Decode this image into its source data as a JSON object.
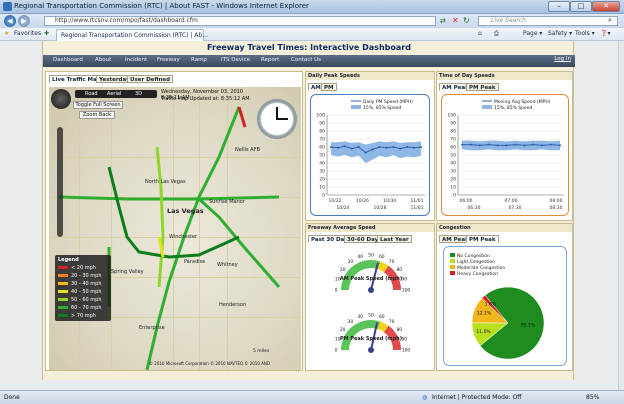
{
  "window": {
    "title": "Regional Transportation Commission (RTC) | About FAST - Windows Internet Explorer",
    "min": "–",
    "max": "□",
    "close": "✕"
  },
  "address": {
    "url": "http://www.rtcsnv.com/mpo/fast/dashboard.cfm",
    "search_placeholder": "Live Search"
  },
  "favbar": {
    "favorites": "Favorites",
    "tab_title": "Regional Transportation Commission (RTC) | Ab...",
    "tools": [
      "Page ▾",
      "Safety ▾",
      "Tools ▾",
      "❓▾"
    ]
  },
  "page": {
    "title": "Freeway Travel Times: Interactive Dashboard",
    "nav": [
      "Dashboard",
      "About",
      "Incident",
      "Freeway",
      "Ramp",
      "ITS Device",
      "Report",
      "Contact Us"
    ],
    "login": "Log In"
  },
  "map_panel": {
    "tabs": [
      "Live Traffic Map",
      "Yesterday",
      "User Defined"
    ],
    "modes": [
      "Road",
      "Aerial",
      "3D"
    ],
    "timestamp": "Wednesday, November 03, 2010 8:35:11 AM",
    "updated": "Traffic Map Updated at: 8:35:12 AM",
    "toggle_label": "Toggle Full Screen",
    "zoom_back_label": "Zoom Back",
    "legend_title": "Legend",
    "legend": [
      {
        "label": "< 20 mph",
        "color": "#d62020"
      },
      {
        "label": "20 - 30 mph",
        "color": "#f07d1e"
      },
      {
        "label": "30 - 40 mph",
        "color": "#f0b81e"
      },
      {
        "label": "40 - 50 mph",
        "color": "#e2e21e"
      },
      {
        "label": "50 - 60 mph",
        "color": "#8ed62b"
      },
      {
        "label": "60 - 70 mph",
        "color": "#2fae2f"
      },
      {
        "label": "> 70 mph",
        "color": "#0b7d1a"
      }
    ],
    "places": [
      "Las Vegas",
      "North Las Vegas",
      "Winchester",
      "Paradise",
      "Spring Valley",
      "Henderson",
      "Enterprise",
      "Whitney",
      "Sunrise Manor",
      "Nellis AFB"
    ],
    "copyright": "© 2010 Microsoft Corporation   © 2010 NAVTEQ   © 2010 AND",
    "scale": "5 miles"
  },
  "daily_peak": {
    "title": "Daily Peak Speeds",
    "tabs": [
      "AM",
      "PM"
    ],
    "legend": [
      "Daily PM Speed (MPH)",
      "15%, 85% Speed"
    ],
    "chart_data": {
      "type": "line",
      "ylim": [
        0,
        100
      ],
      "y_ticks": [
        0,
        10,
        20,
        30,
        40,
        50,
        60,
        70,
        80,
        90,
        100
      ],
      "x_ticks_top": [
        "10/22",
        "10/26",
        "10/30",
        "11/01"
      ],
      "x_ticks_bottom": [
        "10/24",
        "10/28",
        "11/01"
      ],
      "series": [
        {
          "name": "Daily PM Speed (MPH)",
          "values": [
            60,
            59,
            61,
            58,
            60,
            53,
            57,
            60,
            59,
            60,
            58,
            60,
            59,
            60
          ]
        },
        {
          "name": "15%, 85% Speed",
          "low": [
            50,
            48,
            50,
            47,
            49,
            40,
            44,
            49,
            47,
            50,
            46,
            48,
            47,
            49
          ],
          "high": [
            66,
            66,
            67,
            65,
            66,
            63,
            65,
            67,
            66,
            67,
            65,
            66,
            66,
            67
          ]
        }
      ]
    }
  },
  "time_of_day": {
    "title": "Time of Day Speeds",
    "tabs": [
      "AM Peak",
      "PM Peak"
    ],
    "legend": [
      "Moving Avg Speed (MPH)",
      "15%, 85% Speed"
    ],
    "chart_data": {
      "type": "line",
      "ylim": [
        0,
        100
      ],
      "y_ticks": [
        0,
        10,
        20,
        30,
        40,
        50,
        60,
        70,
        80,
        90,
        100
      ],
      "x_ticks_top": [
        "06:00",
        "07:00",
        "08:00"
      ],
      "x_ticks_bottom": [
        "06:30",
        "07:30",
        "08:30"
      ],
      "series": [
        {
          "name": "Moving Avg Speed (MPH)",
          "values": [
            63,
            63,
            62,
            63,
            62,
            62,
            63,
            62,
            63,
            62,
            63,
            62
          ]
        },
        {
          "name": "15%, 85% Speed",
          "low": [
            57,
            56,
            56,
            57,
            56,
            56,
            57,
            56,
            56,
            57,
            56,
            56
          ],
          "high": [
            68,
            68,
            67,
            68,
            68,
            67,
            68,
            67,
            68,
            68,
            67,
            68
          ]
        }
      ]
    }
  },
  "freeway_avg": {
    "title": "Freeway Average Speed",
    "tabs": [
      "Past 30 Days",
      "30-60 Days",
      "Last Year"
    ],
    "gauges": [
      {
        "label": "AM Peak Speed (mph)",
        "value": 58,
        "min": 0,
        "max": 100,
        "ticks": [
          "0",
          "10",
          "20",
          "30",
          "40",
          "50",
          "60",
          "70",
          "80",
          "90",
          "100"
        ]
      },
      {
        "label": "PM Peak Speed (mph)",
        "value": 57,
        "min": 0,
        "max": 100,
        "ticks": [
          "0",
          "10",
          "20",
          "30",
          "40",
          "50",
          "60",
          "70",
          "80",
          "90",
          "100"
        ]
      }
    ]
  },
  "congestion": {
    "title": "Congestion",
    "tabs": [
      "AM Peak",
      "PM Peak"
    ],
    "chart_data": {
      "type": "pie",
      "categories": [
        "No Congestion",
        "Light Congestion",
        "Moderate Congestion",
        "Heavy Congestion"
      ],
      "values": [
        75.1,
        11.0,
        12.1,
        1.8
      ],
      "labels": [
        "75.1%",
        "11.0%",
        "12.1%",
        "1.8%"
      ],
      "colors": [
        "#1f8c1f",
        "#b8e01e",
        "#f2b51b",
        "#d62020"
      ]
    }
  },
  "status": {
    "left": "Done",
    "zone": "Internet | Protected Mode: Off",
    "zoom": "85%"
  },
  "colors": {
    "accent": "#0b2a6d",
    "nav": "#3f4e63",
    "panel_bg": "#f5eed8"
  }
}
